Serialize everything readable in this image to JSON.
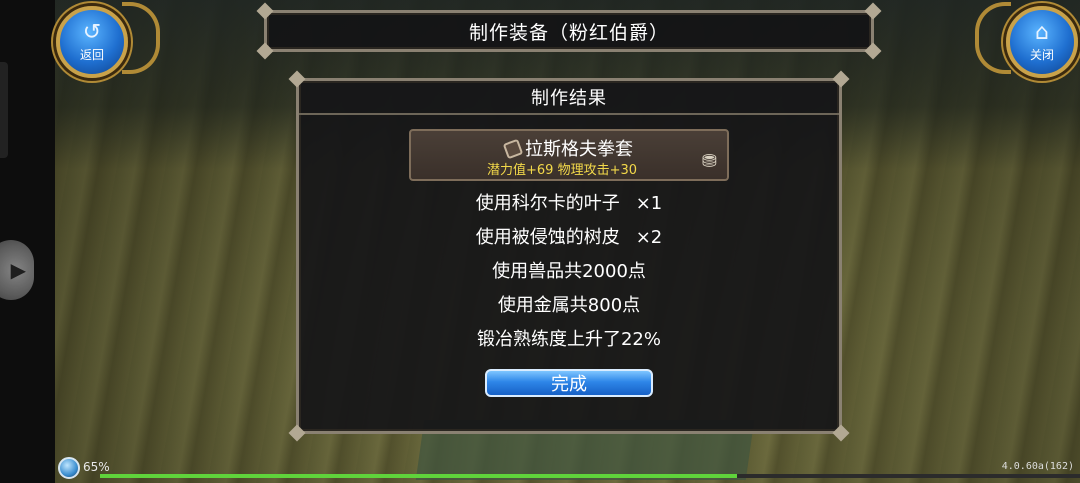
{
  "header": {
    "back_label": "返回",
    "close_label": "关闭",
    "title": "制作装备（粉红伯爵）"
  },
  "dialog": {
    "title": "制作结果",
    "item": {
      "name": "拉斯格夫拳套",
      "stats": "潜力值+69 物理攻击+30"
    },
    "lines": [
      {
        "text": "使用科尔卡的叶子",
        "qty": "×1"
      },
      {
        "text": "使用被侵蚀的树皮",
        "qty": "×2"
      },
      {
        "text": "使用兽品共2000点",
        "qty": ""
      },
      {
        "text": "使用金属共800点",
        "qty": ""
      },
      {
        "text": "锻冶熟练度上升了22%",
        "qty": ""
      }
    ],
    "done_label": "完成"
  },
  "status": {
    "battery_text": "65%",
    "progress": 0.65,
    "version": "4.0.60a(162)"
  },
  "colors": {
    "stat_text": "#f3d94a",
    "button_blue": "#2e86e8",
    "frame": "#8a8172"
  },
  "icons": {
    "back": "back-arrow-icon",
    "close": "home-icon",
    "item": "tag-icon",
    "chest": "chest-icon",
    "side": "play-arrow-icon"
  }
}
